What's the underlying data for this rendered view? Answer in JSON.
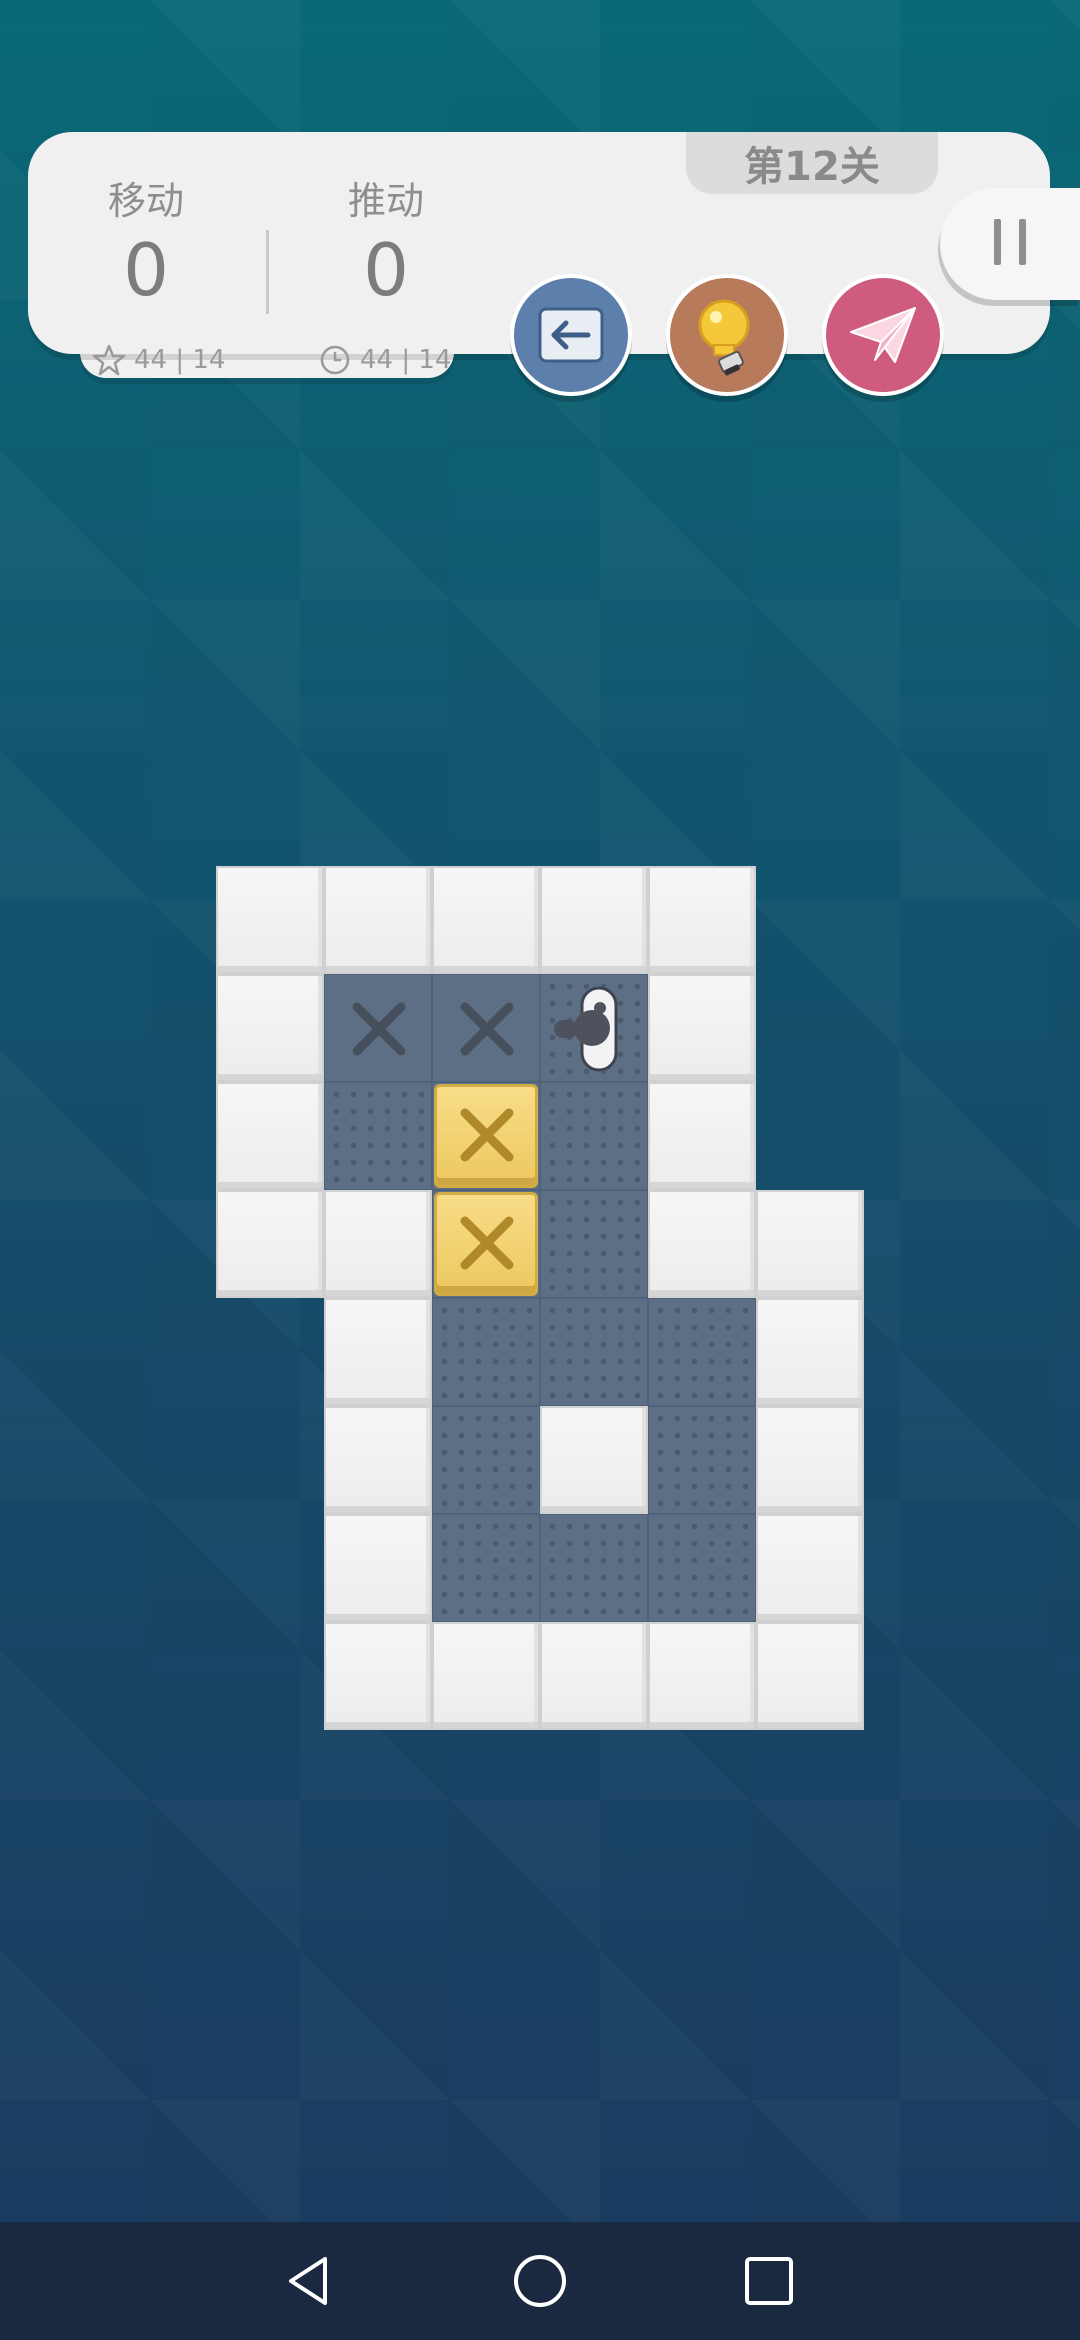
{
  "hud": {
    "level_label": "第12关",
    "moves_label": "移动",
    "moves_value": "0",
    "pushes_label": "推动",
    "pushes_value": "0",
    "best_moves": "44 | 14",
    "best_time": "44 | 14"
  },
  "buttons": {
    "back_icon": "arrow-left-icon",
    "hint_icon": "lightbulb-icon",
    "share_icon": "paper-plane-icon",
    "pause_icon": "pause-icon"
  },
  "board": {
    "legend": {
      "W": "wall",
      "F": "floor",
      "G": "goal",
      "B": "box-on-goal",
      "P": "player",
      "-": "empty"
    },
    "rows": [
      "WWWWW-",
      "WGGPW-",
      "WFBFW-",
      "WWBFWW",
      "-WFFFW",
      "-WFWFW",
      "-WFFFW",
      "-WWWWW"
    ]
  },
  "colors": {
    "background_top": "#096a76",
    "background_bottom": "#1b3a5f",
    "floor": "#5c6f84",
    "box": "#ecc85f",
    "back_button": "#5c80ab",
    "hint_button": "#b77a5b",
    "share_button": "#cf5c7e"
  },
  "navbar": {
    "back": "nav-back-icon",
    "home": "nav-home-icon",
    "recents": "nav-recents-icon"
  }
}
